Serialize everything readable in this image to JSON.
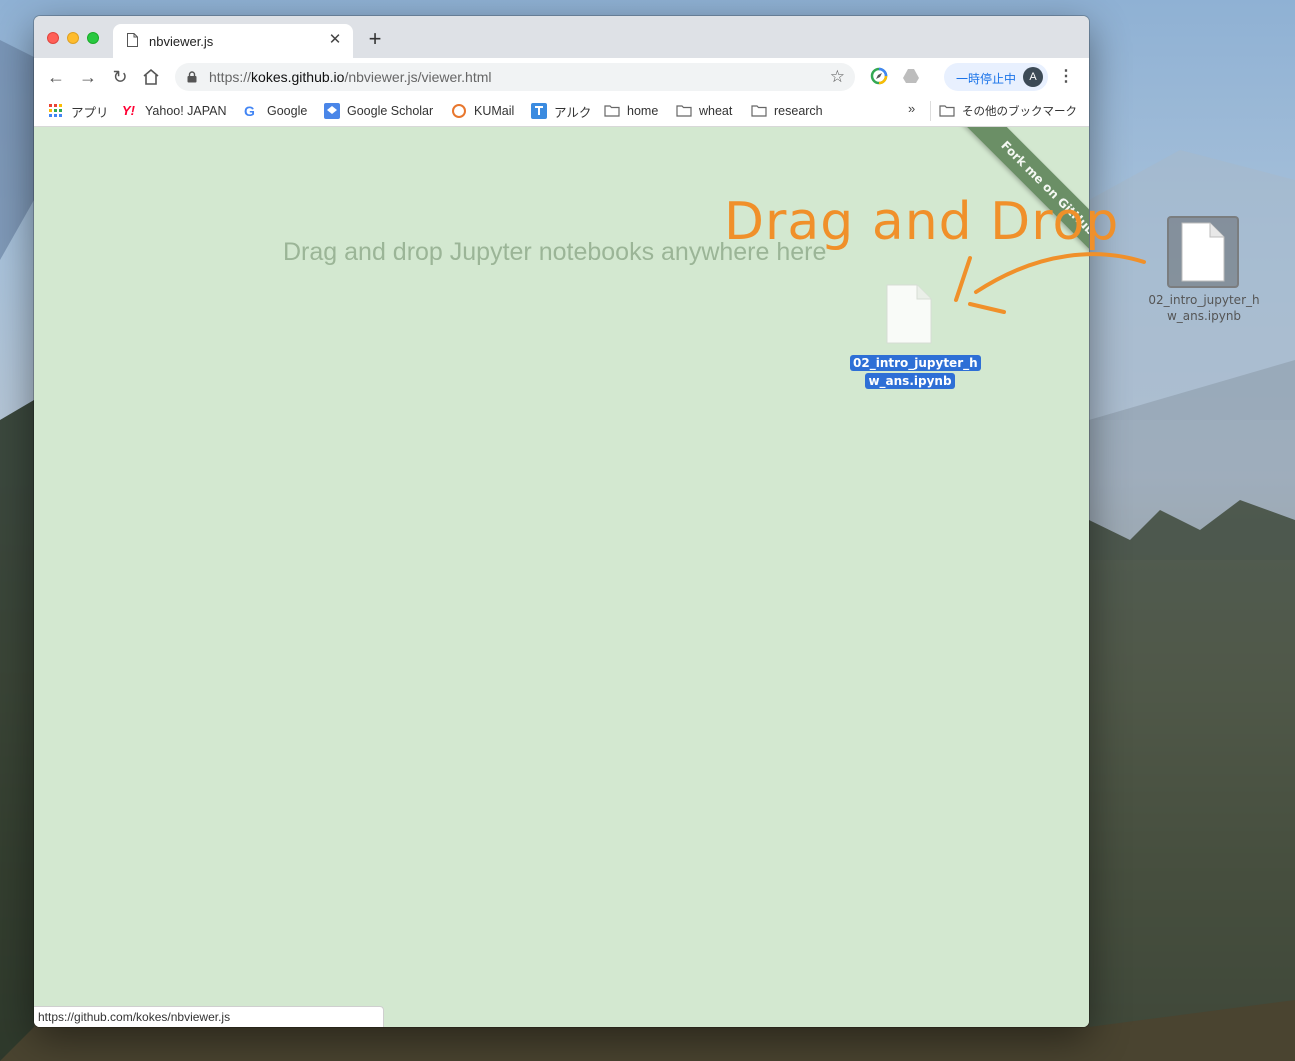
{
  "browser": {
    "tab_title": "nbviewer.js",
    "url_prefix": "https://",
    "url_host": "kokes.github.io",
    "url_path": "/nbviewer.js/viewer.html",
    "pause_label": "一時停止中",
    "avatar_letter": "A",
    "status_url": "https://github.com/kokes/nbviewer.js"
  },
  "bookmarks": [
    {
      "label": "アプリ",
      "icon": "apps-grid-icon"
    },
    {
      "label": "Yahoo! JAPAN",
      "icon": "yahoo-icon"
    },
    {
      "label": "Google",
      "icon": "google-icon"
    },
    {
      "label": "Google Scholar",
      "icon": "scholar-icon"
    },
    {
      "label": "KUMail",
      "icon": "kumail-icon"
    },
    {
      "label": "アルク",
      "icon": "alc-icon"
    },
    {
      "label": "home",
      "icon": "folder-icon"
    },
    {
      "label": "wheat",
      "icon": "folder-icon"
    },
    {
      "label": "research",
      "icon": "folder-icon"
    }
  ],
  "bookmarks_more": "»",
  "other_bookmarks": "その他のブックマーク",
  "page": {
    "drop_hint": "Drag and drop Jupyter notebooks anywhere here",
    "ribbon": "Fork me on GitHub",
    "file_line1": "02_intro_jupyter_h",
    "file_line2": "w_ans.ipynb"
  },
  "desktop": {
    "file_line1": "02_intro_jupyter_h",
    "file_line2": "w_ans.ipynb"
  },
  "annotation": {
    "title": "Drag and Drop",
    "color": "#f0902a"
  },
  "colors": {
    "page_bg": "#d3e8d0",
    "ribbon": "#6b8f66",
    "selection": "#2e6fd6"
  }
}
